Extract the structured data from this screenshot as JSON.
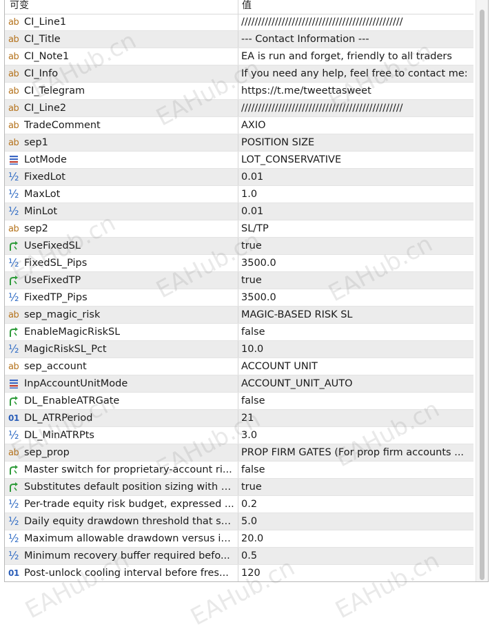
{
  "header": {
    "name_col": "可变",
    "value_col": "值"
  },
  "watermark": "EAHub.cn",
  "rows": [
    {
      "icon": "ab",
      "name": "CI_Line1",
      "value": "////////////////////////////////////////////////"
    },
    {
      "icon": "ab",
      "name": "CI_Title",
      "value": "--- Contact Information ---"
    },
    {
      "icon": "ab",
      "name": "CI_Note1",
      "value": "EA is run and forget, friendly to all traders"
    },
    {
      "icon": "ab",
      "name": "CI_Info",
      "value": "If you need any help, feel free to contact me:"
    },
    {
      "icon": "ab",
      "name": "CI_Telegram",
      "value": "https://t.me/tweettasweet"
    },
    {
      "icon": "ab",
      "name": "CI_Line2",
      "value": "////////////////////////////////////////////////"
    },
    {
      "icon": "ab",
      "name": "TradeComment",
      "value": "AXIO"
    },
    {
      "icon": "ab",
      "name": "sep1",
      "value": "POSITION SIZE"
    },
    {
      "icon": "enum",
      "name": "LotMode",
      "value": "LOT_CONSERVATIVE"
    },
    {
      "icon": "half",
      "name": "FixedLot",
      "value": "0.01"
    },
    {
      "icon": "half",
      "name": "MaxLot",
      "value": "1.0"
    },
    {
      "icon": "half",
      "name": "MinLot",
      "value": "0.01"
    },
    {
      "icon": "ab",
      "name": "sep2",
      "value": "SL/TP"
    },
    {
      "icon": "bool",
      "name": "UseFixedSL",
      "value": "true"
    },
    {
      "icon": "half",
      "name": "FixedSL_Pips",
      "value": "3500.0"
    },
    {
      "icon": "bool",
      "name": "UseFixedTP",
      "value": "true"
    },
    {
      "icon": "half",
      "name": "FixedTP_Pips",
      "value": "3500.0"
    },
    {
      "icon": "ab",
      "name": "sep_magic_risk",
      "value": "MAGIC-BASED RISK SL"
    },
    {
      "icon": "bool",
      "name": "EnableMagicRiskSL",
      "value": "false"
    },
    {
      "icon": "half",
      "name": "MagicRiskSL_Pct",
      "value": "10.0"
    },
    {
      "icon": "ab",
      "name": "sep_account",
      "value": "ACCOUNT UNIT"
    },
    {
      "icon": "enum",
      "name": "InpAccountUnitMode",
      "value": "ACCOUNT_UNIT_AUTO"
    },
    {
      "icon": "bool",
      "name": "DL_EnableATRGate",
      "value": "false"
    },
    {
      "icon": "int",
      "name": "DL_ATRPeriod",
      "value": "21"
    },
    {
      "icon": "half",
      "name": "DL_MinATRPts",
      "value": "3.0"
    },
    {
      "icon": "ab",
      "name": "sep_prop",
      "value": "PROP FIRM GATES (For prop firm accounts ..."
    },
    {
      "icon": "bool",
      "name": "Master switch for proprietary-account ri...",
      "value": "false"
    },
    {
      "icon": "bool",
      "name": "Substitutes default position sizing with P...",
      "value": "true"
    },
    {
      "icon": "half",
      "name": "Per-trade equity risk budget, expressed ...",
      "value": "0.2"
    },
    {
      "icon": "half",
      "name": "Daily equity drawdown threshold that su...",
      "value": "5.0"
    },
    {
      "icon": "half",
      "name": "Maximum allowable drawdown versus in...",
      "value": "20.0"
    },
    {
      "icon": "half",
      "name": "Minimum recovery buffer required befo...",
      "value": "0.5"
    },
    {
      "icon": "int",
      "name": "Post-unlock cooling interval before fres...",
      "value": "120"
    }
  ]
}
